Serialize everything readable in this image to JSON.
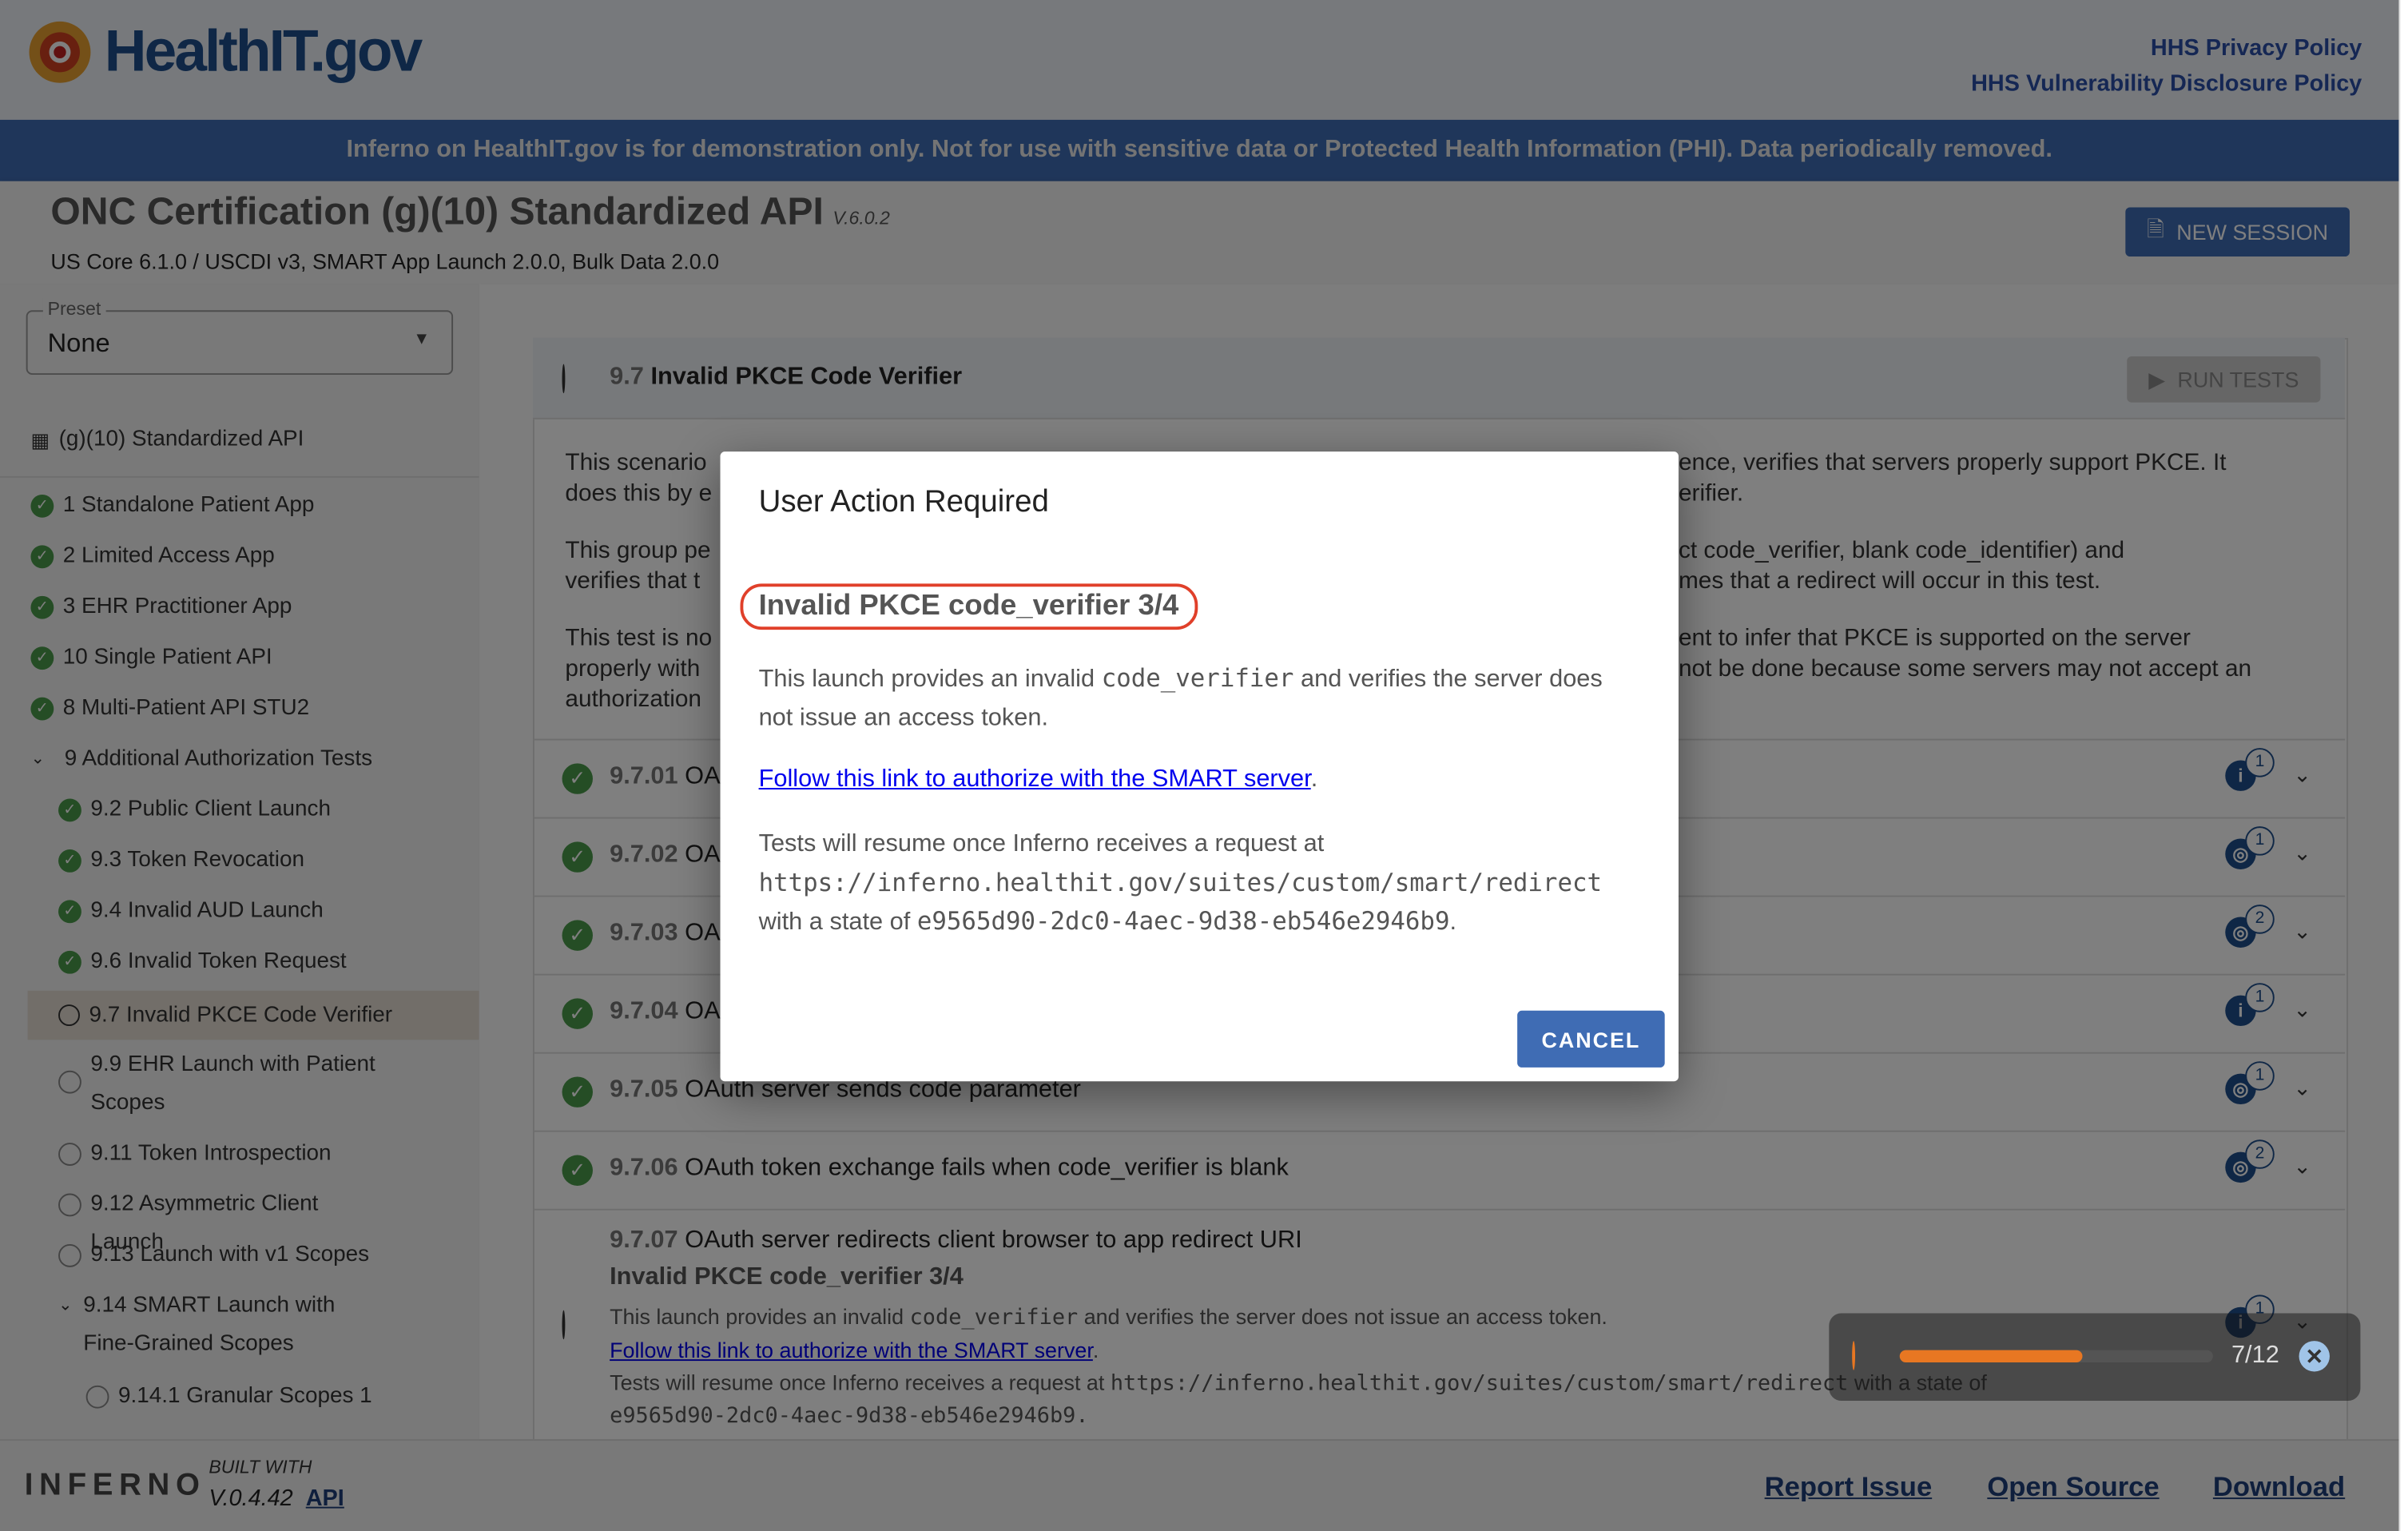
{
  "header": {
    "logo_text": "HealthIT.gov",
    "links": [
      "HHS Privacy Policy",
      "HHS Vulnerability Disclosure Policy"
    ]
  },
  "banner": "Inferno on HealthIT.gov is for demonstration only. Not for use with sensitive data or Protected Health Information (PHI). Data periodically removed.",
  "suite": {
    "title": "ONC Certification (g)(10) Standardized API",
    "version": "V.6.0.2",
    "subtitle": "US Core 6.1.0 / USCDI v3, SMART App Launch 2.0.0, Bulk Data 2.0.0",
    "new_session": "NEW SESSION"
  },
  "sidebar": {
    "preset_label": "Preset",
    "preset_value": "None",
    "root": "(g)(10) Standardized API",
    "items": [
      {
        "label": "1 Standalone Patient App",
        "status": "pass"
      },
      {
        "label": "2 Limited Access App",
        "status": "pass"
      },
      {
        "label": "3 EHR Practitioner App",
        "status": "pass"
      },
      {
        "label": "10 Single Patient API",
        "status": "pass"
      },
      {
        "label": "8 Multi-Patient API STU2",
        "status": "pass"
      },
      {
        "label": "9 Additional Authorization Tests",
        "status": "expanded"
      },
      {
        "label": "9.2 Public Client Launch",
        "status": "pass"
      },
      {
        "label": "9.3 Token Revocation",
        "status": "pass"
      },
      {
        "label": "9.4 Invalid AUD Launch",
        "status": "pass"
      },
      {
        "label": "9.6 Invalid Token Request",
        "status": "pass"
      },
      {
        "label": "9.7 Invalid PKCE Code Verifier",
        "status": "running"
      },
      {
        "label": "9.9 EHR Launch with Patient Scopes",
        "status": "none"
      },
      {
        "label": "9.11 Token Introspection",
        "status": "none"
      },
      {
        "label": "9.12 Asymmetric Client Launch",
        "status": "none"
      },
      {
        "label": "9.13 Launch with v1 Scopes",
        "status": "none"
      },
      {
        "label": "9.14 SMART Launch with Fine-Grained Scopes",
        "status": "expanded"
      },
      {
        "label": "9.14.1 Granular Scopes 1",
        "status": "none"
      }
    ]
  },
  "group": {
    "number": "9.7",
    "title": "Invalid PKCE Code Verifier",
    "run_tests": "RUN TESTS",
    "desc_left": [
      "This scenario",
      "does this by e",
      "This group pe",
      "verifies that t",
      "This test is no",
      "properly with",
      "authorization"
    ],
    "desc_right": [
      "ence, verifies that servers properly support PKCE. It",
      "erifier.",
      "ct code_verifier, blank code_identifier) and",
      "mes that a redirect will occur in this test.",
      "ent to infer that PKCE is supported on the server",
      "not be done because some servers may not accept an"
    ],
    "tests": [
      {
        "num": "9.7.01",
        "title": "OA",
        "icon": "info",
        "count": "1"
      },
      {
        "num": "9.7.02",
        "title": "OA",
        "icon": "globe",
        "count": "1"
      },
      {
        "num": "9.7.03",
        "title": "OA",
        "icon": "globe",
        "count": "2"
      },
      {
        "num": "9.7.04",
        "title": "OA",
        "icon": "info",
        "count": "1"
      },
      {
        "num": "9.7.05",
        "title": "OAuth server sends code parameter",
        "icon": "globe",
        "count": "1"
      },
      {
        "num": "9.7.06",
        "title": "OAuth token exchange fails when code_verifier is blank",
        "icon": "globe",
        "count": "2"
      }
    ],
    "current": {
      "num": "9.7.07",
      "title": "OAuth server redirects client browser to app redirect URI",
      "sub": "Invalid PKCE code_verifier 3/4",
      "l1a": "This launch provides an invalid",
      "l1code": "code_verifier",
      "l1b": "and verifies the server does not issue an access token.",
      "link": "Follow this link to authorize with the SMART server",
      "l3a": "Tests will resume once Inferno receives a request at",
      "l3url": "https://inferno.healthit.gov/suites/custom/smart/redirect",
      "l3b": "with a state of",
      "state": "e9565d90-2dc0-4aec-9d38-eb546e2946b9.",
      "count": "1"
    }
  },
  "progress": {
    "completed": 7,
    "total": 12,
    "label": "7/12"
  },
  "modal": {
    "title": "User Action Required",
    "heading": "Invalid PKCE code_verifier 3/4",
    "p1a": "This launch provides an invalid",
    "p1code": "code_verifier",
    "p1b": "and verifies the server does not issue an access token.",
    "link": "Follow this link to authorize with the SMART server",
    "p3a": "Tests will resume once Inferno receives a request at",
    "url": "https://inferno.healthit.gov/suites/custom/smart/redirect",
    "p3b": "with a state of",
    "state": "e9565d90-2dc0-4aec-9d38-eb546e2946b9",
    "cancel": "CANCEL"
  },
  "footer": {
    "logo": "INFERNO",
    "built_with": "BUILT WITH",
    "version": "V.0.4.42",
    "api": "API",
    "links": [
      "Report Issue",
      "Open Source",
      "Download"
    ]
  },
  "colors": {
    "accent": "#3f6cb4",
    "pass": "#4a9a4a",
    "highlight": "#e0402a",
    "progress": "#e87722"
  }
}
